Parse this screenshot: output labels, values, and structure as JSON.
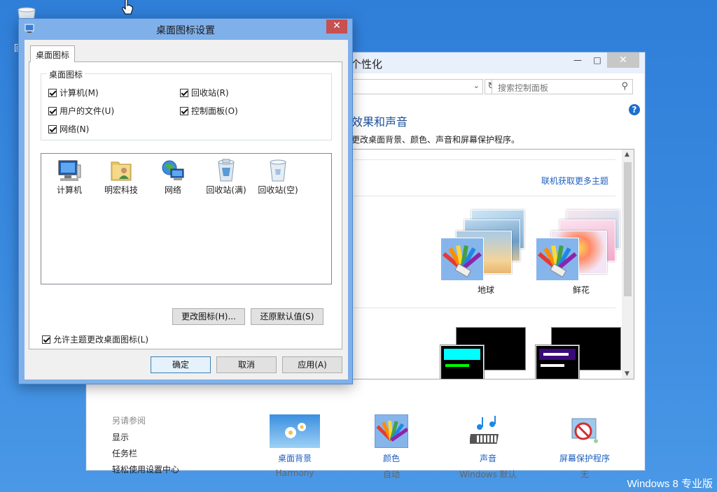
{
  "desktop": {
    "watermark": "Windows 8 专业版",
    "icon_label_fragment": "回"
  },
  "personalization": {
    "title": "个性化",
    "search_placeholder": "搜索控制面板",
    "heading": "效果和声音",
    "description": "更改桌面背景、颜色、声音和屏幕保护程序。",
    "get_more_themes": "联机获取更多主题",
    "themes": [
      {
        "name": "地球"
      },
      {
        "name": "鲜花"
      }
    ],
    "see_also": {
      "title": "另请参阅",
      "links": [
        "显示",
        "任务栏",
        "轻松使用设置中心"
      ]
    },
    "bottom_items": [
      {
        "label": "桌面背景",
        "sub": "Harmony"
      },
      {
        "label": "颜色",
        "sub": "自动"
      },
      {
        "label": "声音",
        "sub": "Windows 默认"
      },
      {
        "label": "屏幕保护程序",
        "sub": "无"
      }
    ],
    "colors": {
      "link": "#1e5fbf",
      "heading": "#1b4f9a"
    }
  },
  "dialog": {
    "title": "桌面图标设置",
    "close_glyph": "✕",
    "tab": "桌面图标",
    "group_label": "桌面图标",
    "checkboxes": [
      {
        "label": "计算机(M)",
        "checked": true
      },
      {
        "label": "回收站(R)",
        "checked": true
      },
      {
        "label": "用户的文件(U)",
        "checked": true
      },
      {
        "label": "控制面板(O)",
        "checked": true
      },
      {
        "label": "网络(N)",
        "checked": true
      }
    ],
    "icons": [
      {
        "label": "计算机",
        "icon": "computer-icon"
      },
      {
        "label": "明宏科技",
        "icon": "user-folder-icon"
      },
      {
        "label": "网络",
        "icon": "network-icon"
      },
      {
        "label": "回收站(满)",
        "icon": "recycle-bin-full-icon"
      },
      {
        "label": "回收站(空)",
        "icon": "recycle-bin-empty-icon"
      }
    ],
    "change_icon_button": "更改图标(H)...",
    "restore_default_button": "还原默认值(S)",
    "allow_themes_label": "允许主题更改桌面图标(L)",
    "allow_themes_checked": true,
    "ok_button": "确定",
    "cancel_button": "取消",
    "apply_button": "应用(A)"
  }
}
